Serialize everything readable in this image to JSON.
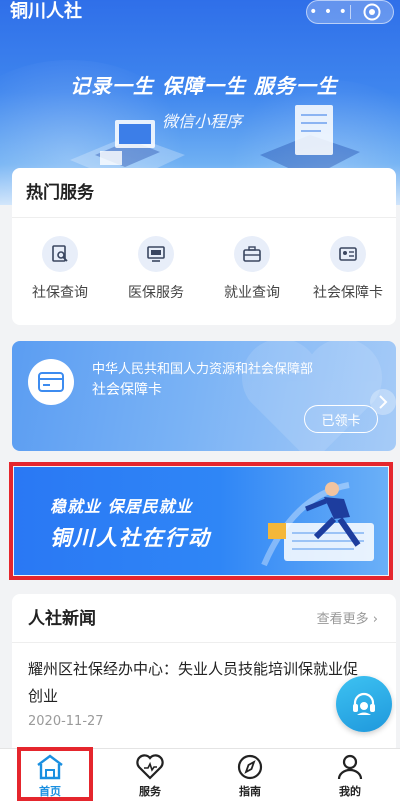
{
  "app": {
    "title": "铜川人社"
  },
  "hero": {
    "slogan": "记录一生 保障一生 服务一生",
    "subtitle": "微信小程序"
  },
  "hot_services": {
    "title": "热门服务",
    "items": [
      {
        "label": "社保查询",
        "icon": "document-search-icon"
      },
      {
        "label": "医保服务",
        "icon": "monitor-icon"
      },
      {
        "label": "就业查询",
        "icon": "briefcase-icon"
      },
      {
        "label": "社会保障卡",
        "icon": "id-card-icon"
      }
    ]
  },
  "ss_card": {
    "issuer": "中华人民共和国人力资源和社会保障部",
    "name": "社会保障卡",
    "status": "已领卡"
  },
  "banner": {
    "line1": "稳就业 保居民就业",
    "line2": "铜川人社在行动"
  },
  "news": {
    "title": "人社新闻",
    "more": "查看更多",
    "items": [
      {
        "headline": "耀州区社保经办中心：失业人员技能培训保就业促创业",
        "date": "2020-11-27"
      }
    ]
  },
  "tabs": [
    {
      "label": "首页",
      "icon": "home-icon",
      "active": true
    },
    {
      "label": "服务",
      "icon": "heart-icon",
      "active": false
    },
    {
      "label": "指南",
      "icon": "compass-icon",
      "active": false
    },
    {
      "label": "我的",
      "icon": "user-icon",
      "active": false
    }
  ],
  "colors": {
    "primary": "#2f6fe9",
    "active_tab": "#1a8fe0",
    "highlight": "#e5262d"
  }
}
